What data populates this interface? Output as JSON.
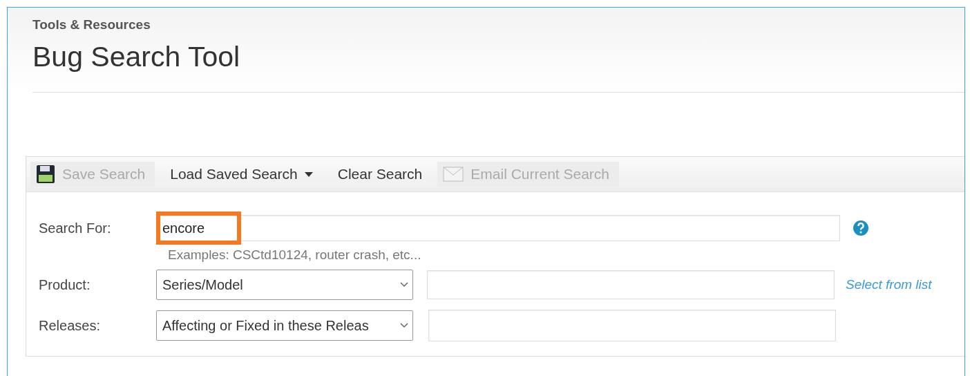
{
  "header": {
    "breadcrumb": "Tools & Resources",
    "title": "Bug Search Tool"
  },
  "toolbar": [
    {
      "kind": "save",
      "label": "Save Search",
      "disabled": true
    },
    {
      "kind": "dropdown",
      "label": "Load Saved Search",
      "disabled": false
    },
    {
      "kind": "plain",
      "label": "Clear Search",
      "disabled": false
    },
    {
      "kind": "email",
      "label": "Email Current Search",
      "disabled": true
    }
  ],
  "search": {
    "label": "Search For:",
    "value": "encore",
    "highlighted": true,
    "hint": "Examples: CSCtd10124, router crash, etc..."
  },
  "product": {
    "label": "Product:",
    "select": "Series/Model",
    "link": "Select from list"
  },
  "releases": {
    "label": "Releases:",
    "select": "Affecting or Fixed in these Releas"
  }
}
